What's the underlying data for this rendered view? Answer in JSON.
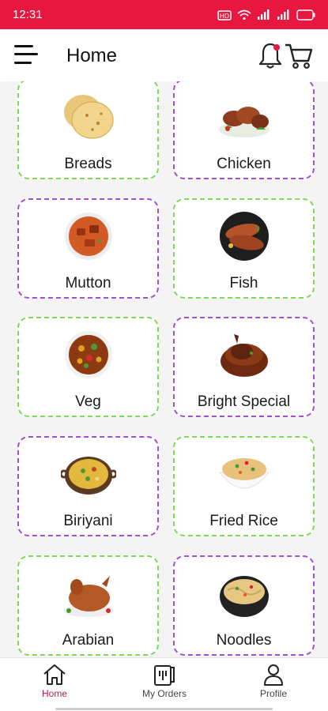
{
  "status_bar": {
    "time": "12:31",
    "battery": "65"
  },
  "header": {
    "title": "Home"
  },
  "categories": [
    {
      "name": "Breads",
      "border": "green"
    },
    {
      "name": "Chicken",
      "border": "purple"
    },
    {
      "name": "Mutton",
      "border": "purple"
    },
    {
      "name": "Fish",
      "border": "green"
    },
    {
      "name": "Veg",
      "border": "green"
    },
    {
      "name": "Bright Special",
      "border": "purple"
    },
    {
      "name": "Biriyani",
      "border": "purple"
    },
    {
      "name": "Fried Rice",
      "border": "green"
    },
    {
      "name": "Arabian",
      "border": "green"
    },
    {
      "name": "Noodles",
      "border": "purple"
    }
  ],
  "bottom_nav": {
    "home": "Home",
    "orders": "My Orders",
    "profile": "Profile"
  },
  "colors": {
    "brand": "#e8173f",
    "border_green": "#7ed957",
    "border_purple": "#a34fcf",
    "active_nav": "#c2185b"
  }
}
